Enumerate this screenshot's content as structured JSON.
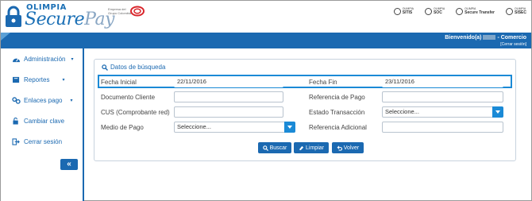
{
  "brand": {
    "top": "OLIMPIA",
    "secure": "Secure",
    "pay": "Pay",
    "empresa": "Empresa del Grupo Colombia",
    "partners": [
      {
        "name": "SITIS",
        "sub": "OLIMPIA"
      },
      {
        "name": "SOC",
        "sub": "OLIMPIA"
      },
      {
        "name": "Secure Transfer",
        "sub": "OLIMPIA"
      },
      {
        "name": "SISEC",
        "sub": "OLIMPIA"
      }
    ]
  },
  "header": {
    "welcome_prefix": "Bienvenido(a)",
    "welcome_suffix": "- Comercio",
    "logout": "[Cerrar sesión]"
  },
  "sidebar": {
    "items": [
      {
        "label": "Administración",
        "icon": "dashboard-icon",
        "caret": "▾"
      },
      {
        "label": "Reportes",
        "icon": "book-icon",
        "caret": "▾"
      },
      {
        "label": "Enlaces pago",
        "icon": "link-icon",
        "caret": "▾"
      },
      {
        "label": "Cambiar clave",
        "icon": "unlock-icon",
        "caret": ""
      },
      {
        "label": "Cerrar sesión",
        "icon": "sign-out-icon",
        "caret": ""
      }
    ],
    "collapse": "«"
  },
  "panel": {
    "title": "Datos de búsqueda",
    "fields": {
      "fecha_inicial": {
        "label": "Fecha Inicial",
        "value": "22/11/2016"
      },
      "fecha_fin": {
        "label": "Fecha Fin",
        "value": "23/11/2016"
      },
      "documento_cliente": {
        "label": "Documento Cliente",
        "value": ""
      },
      "referencia_pago": {
        "label": "Referencia de Pago",
        "value": ""
      },
      "cus": {
        "label": "CUS (Comprobante red)",
        "value": ""
      },
      "estado_transaccion": {
        "label": "Estado Transacción",
        "value": "Seleccione..."
      },
      "medio_pago": {
        "label": "Medio de Pago",
        "value": "Seleccione..."
      },
      "referencia_adicional": {
        "label": "Referencia Adicional",
        "value": ""
      }
    },
    "buttons": {
      "buscar": "Buscar",
      "limpiar": "Limpiar",
      "volver": "Volver"
    }
  },
  "colors": {
    "primary": "#1b69b1",
    "accent": "#1b8ad6"
  }
}
